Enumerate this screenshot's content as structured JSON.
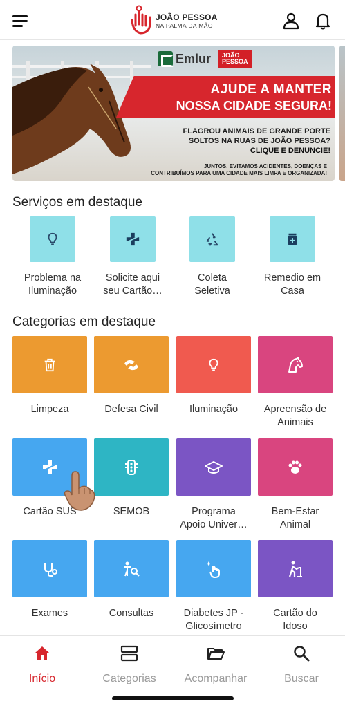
{
  "header": {
    "logo_title": "JOÃO PESSOA",
    "logo_subtitle": "NA PALMA DA MÃO",
    "brand_color": "#d7262d"
  },
  "banner": {
    "partner": "Emlur",
    "badge_line1": "JOÃO",
    "badge_line2": "PESSOA",
    "headline1": "AJUDE A MANTER",
    "headline2": "NOSSA CIDADE SEGURA!",
    "body1": "FLAGROU ANIMAIS DE GRANDE PORTE",
    "body2": "SOLTOS NA RUAS DE JOÃO PESSOA?",
    "cta": "CLIQUE E DENUNCIE!",
    "footer1": "JUNTOS, EVITAMOS ACIDENTES, DOENÇAS E",
    "footer2": "CONTRIBUÍMOS PARA UMA CIDADE MAIS LIMPA E ORGANIZADA!"
  },
  "services": {
    "title": "Serviços em destaque",
    "items": [
      {
        "line1": "Problema na",
        "line2": "Iluminação",
        "icon": "lightbulb-icon"
      },
      {
        "line1": "Solicite aqui",
        "line2": "seu Cartão…",
        "icon": "health-cross-icon"
      },
      {
        "line1": "Coleta",
        "line2": "Seletiva",
        "icon": "recycle-icon"
      },
      {
        "line1": "Remedio em",
        "line2": "Casa",
        "icon": "medicine-icon"
      }
    ]
  },
  "categories": {
    "title": "Categorias em destaque",
    "items": [
      {
        "line1": "Limpeza",
        "line2": "",
        "color": "#ec9a30",
        "icon": "trash-icon"
      },
      {
        "line1": "Defesa Civil",
        "line2": "",
        "color": "#ec9a30",
        "icon": "defesa-civil-icon"
      },
      {
        "line1": "Iluminação",
        "line2": "",
        "color": "#f05a4f",
        "icon": "lightbulb-icon"
      },
      {
        "line1": "Apreensão de",
        "line2": "Animais",
        "color": "#d9457f",
        "icon": "horse-icon"
      },
      {
        "line1": "Cartão SUS",
        "line2": "",
        "color": "#46a7f0",
        "icon": "health-cross-icon"
      },
      {
        "line1": "SEMOB",
        "line2": "",
        "color": "#2eb5c4",
        "icon": "traffic-light-icon"
      },
      {
        "line1": "Programa",
        "line2": "Apoio Univer…",
        "color": "#7b55c4",
        "icon": "graduation-cap-icon"
      },
      {
        "line1": "Bem-Estar",
        "line2": "Animal",
        "color": "#d9457f",
        "icon": "paw-icon"
      },
      {
        "line1": "Exames",
        "line2": "",
        "color": "#46a7f0",
        "icon": "stethoscope-icon"
      },
      {
        "line1": "Consultas",
        "line2": "",
        "color": "#46a7f0",
        "icon": "doctor-search-icon"
      },
      {
        "line1": "Diabetes JP -",
        "line2": "Glicosímetro",
        "color": "#46a7f0",
        "icon": "glucose-finger-icon"
      },
      {
        "line1": "Cartão do",
        "line2": "Idoso",
        "color": "#7b55c4",
        "icon": "elderly-icon"
      }
    ]
  },
  "nav": {
    "items": [
      {
        "label": "Início",
        "icon": "home-icon",
        "active": true
      },
      {
        "label": "Categorias",
        "icon": "categories-icon",
        "active": false
      },
      {
        "label": "Acompanhar",
        "icon": "folder-icon",
        "active": false
      },
      {
        "label": "Buscar",
        "icon": "search-icon",
        "active": false
      }
    ]
  }
}
